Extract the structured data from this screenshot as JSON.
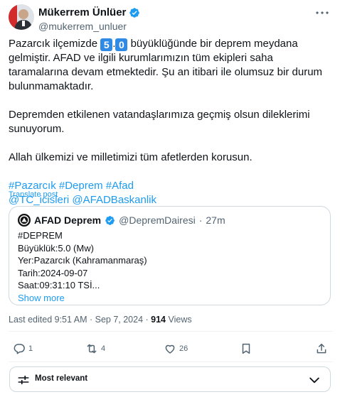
{
  "author": {
    "name": "Mükerrem Ünlüer",
    "handle": "@mukerrem_unluer"
  },
  "tweet": {
    "line1_pre": "Pazarcık ilçemizde",
    "digit1": "5",
    "dot": ".",
    "digit2": "0",
    "line1_post": "büyüklüğünde bir deprem meydana gelmiştir.",
    "para1_rest": "AFAD ve ilgili kurumlarımızın tüm ekipleri saha taramalarına devam etmektedir. Şu an itibari ile olumsuz bir durum bulunmamaktadır.",
    "para2": "Depremden etkilenen vatandaşlarımıza geçmiş olsun dileklerimi sunuyorum.",
    "para3": "Allah ülkemizi ve milletimizi tüm afetlerden korusun.",
    "hashtags": [
      "#Pazarcık",
      "#Deprem",
      "#Afad"
    ],
    "mentions": [
      "@TC_icisleri",
      "@AFADBaskanlik"
    ]
  },
  "translate_label": "Translate post",
  "quote": {
    "name": "AFAD Deprem",
    "handle": "@DepremDairesi",
    "separator": "·",
    "time": "27m",
    "lines": [
      "#DEPREM",
      "Büyüklük:5.0 (Mw)",
      "Yer:Pazarcık (Kahramanmaraş)",
      "Tarih:2024-09-07",
      "Saat:09:31:10 TSİ..."
    ],
    "show_more": "Show more"
  },
  "meta": {
    "edited": "Last edited 9:51 AM · Sep 7, 2024 ·",
    "views_count": "914",
    "views_label": "Views"
  },
  "actions": {
    "replies": "1",
    "reposts": "4",
    "likes": "26"
  },
  "sort": {
    "label": "Most relevant"
  },
  "colors": {
    "accent": "#1d9bf0",
    "emoji_box": "#2f8ae6",
    "text": "#0f1419",
    "muted": "#536471",
    "border": "#cfd9de"
  }
}
